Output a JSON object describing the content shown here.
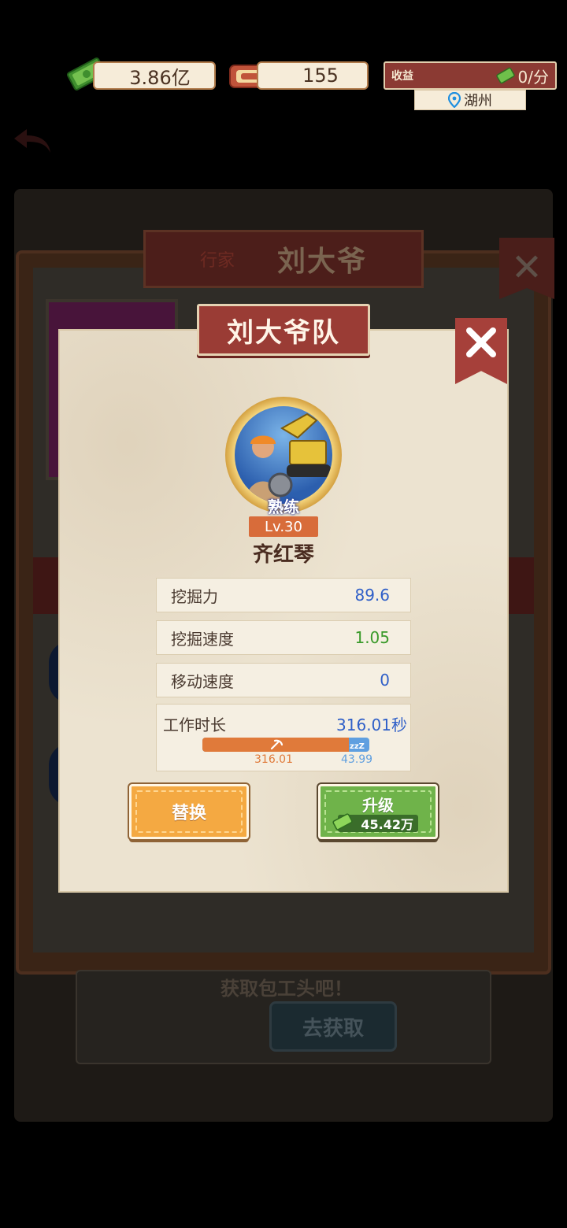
{
  "hud": {
    "cash": "3.86亿",
    "tickets": "155",
    "income_label": "收益",
    "income_rate": "0/分",
    "location": "湖州"
  },
  "background": {
    "tag": "行家",
    "name": "刘大爷",
    "hint": "获取包工头吧！",
    "go_button": "去获取"
  },
  "dialog": {
    "title": "刘大爷队",
    "skill_level": "熟练",
    "level": "Lv.30",
    "worker_name": "齐红琴",
    "stats": [
      {
        "label": "挖掘力",
        "value": "89.6"
      },
      {
        "label": "挖掘速度",
        "value": "1.05"
      },
      {
        "label": "移动速度",
        "value": "0"
      }
    ],
    "work": {
      "label": "工作时长",
      "value": "316.01秒",
      "active": "316.01",
      "rest": "43.99",
      "active_fraction": 0.878
    },
    "replace_button": "替换",
    "upgrade_button": "升级",
    "upgrade_cost": "45.42万"
  },
  "colors": {
    "accent_red": "#9a3c35",
    "stat_blue": "#2f5fc8",
    "stat_green": "#3a9a2a",
    "bar_orange": "#e07a3a",
    "bar_blue": "#5f9fe0"
  }
}
